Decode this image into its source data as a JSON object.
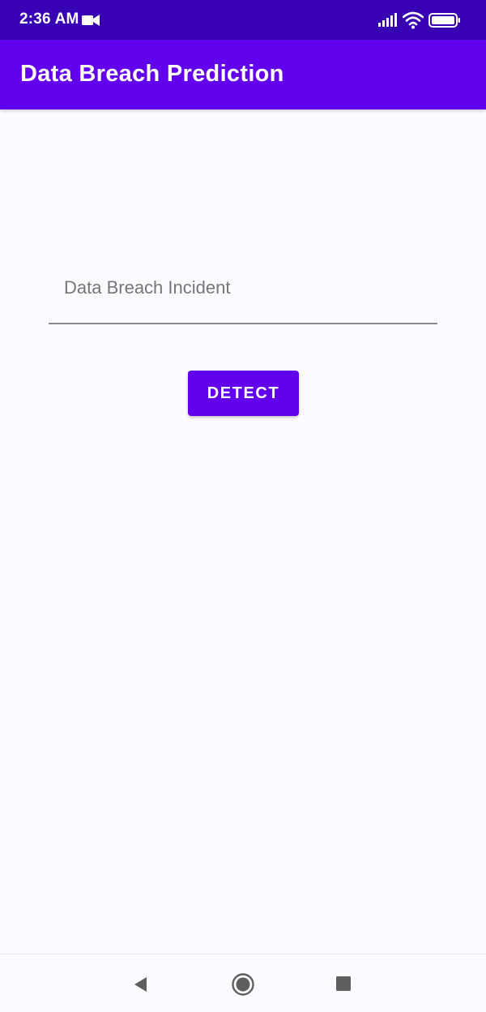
{
  "status_bar": {
    "time": "2:36 AM",
    "icons": [
      "video-camera-icon",
      "cell-signal-icon",
      "wifi-icon",
      "battery-icon"
    ]
  },
  "app_bar": {
    "title": "Data Breach Prediction"
  },
  "form": {
    "input_placeholder": "Data Breach Incident",
    "input_value": "",
    "detect_label": "DETECT"
  },
  "nav_bar": {
    "icons": [
      "back-icon",
      "home-icon",
      "recents-icon"
    ]
  },
  "colors": {
    "status_bar": "#3700b3",
    "primary": "#6200ee",
    "background": "#fdfbff",
    "on_primary": "#ffffff",
    "hint_text": "#5f5f63",
    "underline": "#8a8a8d",
    "nav_icon": "#5f5f5f"
  }
}
